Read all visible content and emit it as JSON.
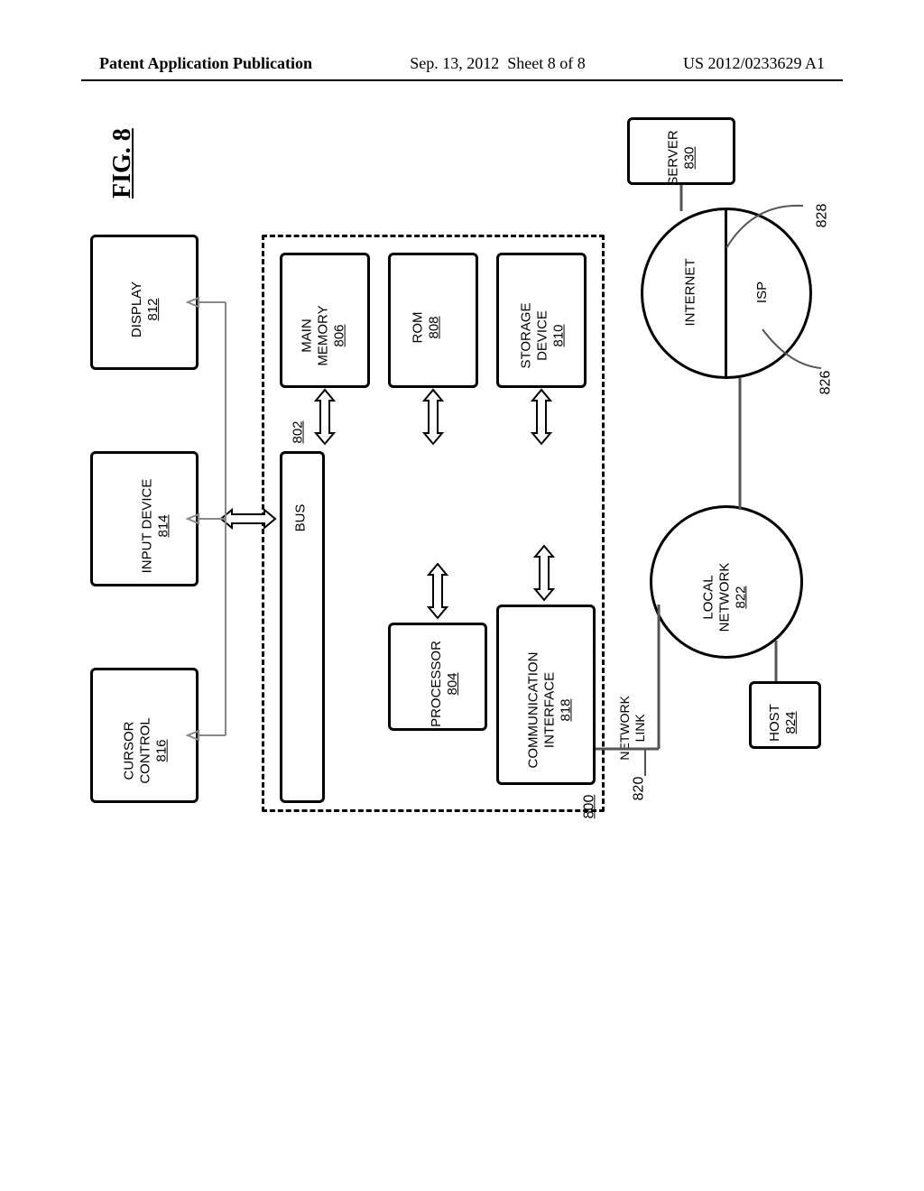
{
  "header": {
    "publication_type": "Patent Application Publication",
    "date": "Sep. 13, 2012",
    "sheet": "Sheet 8 of 8",
    "pub_no": "US 2012/0233629 A1"
  },
  "figure_label": "FIG. 8",
  "blocks": {
    "display": {
      "label": "DISPLAY",
      "ref": "812"
    },
    "input_device": {
      "label": "INPUT DEVICE",
      "ref": "814"
    },
    "cursor_control": {
      "label": "CURSOR",
      "label2": "CONTROL",
      "ref": "816"
    },
    "main_memory": {
      "label": "MAIN",
      "label2": "MEMORY",
      "ref": "806"
    },
    "rom": {
      "label": "ROM",
      "ref": "808"
    },
    "storage_device": {
      "label": "STORAGE",
      "label2": "DEVICE",
      "ref": "810"
    },
    "bus": {
      "label": "BUS",
      "ref": "802"
    },
    "processor": {
      "label": "PROCESSOR",
      "ref": "804"
    },
    "comm_interface": {
      "label": "COMMUNICATION",
      "label2": "INTERFACE",
      "ref": "818"
    },
    "server": {
      "label": "SERVER",
      "ref": "830"
    },
    "host": {
      "label": "HOST",
      "ref": "824"
    },
    "internet": {
      "label": "INTERNET",
      "ref": "828"
    },
    "isp": {
      "label": "ISP",
      "ref": "826"
    },
    "local_network": {
      "label": "LOCAL",
      "label2": "NETWORK",
      "ref": "822"
    },
    "network_link": {
      "label": "NETWORK",
      "label2": "LINK",
      "ref": "820"
    },
    "system": {
      "ref": "800"
    }
  }
}
